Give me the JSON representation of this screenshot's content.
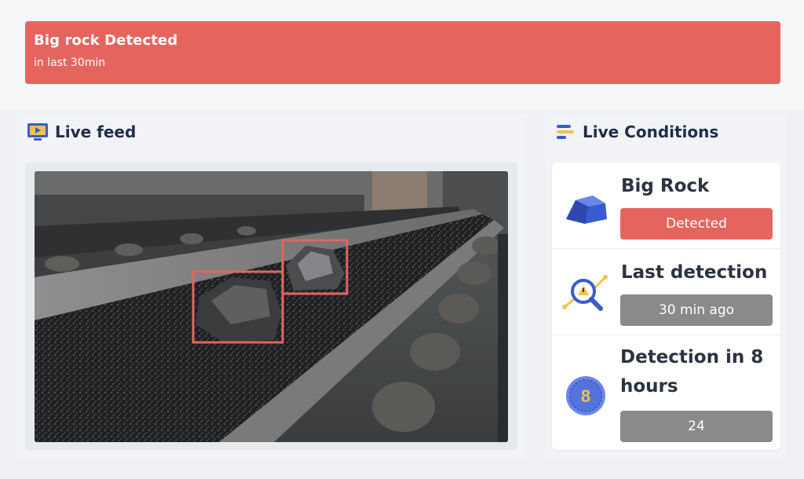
{
  "alert": {
    "title": "Big rock Detected",
    "subtitle": "in last 30min",
    "color": "#e5655e"
  },
  "feed": {
    "title": "Live feed",
    "icon": "video-play-icon"
  },
  "conditions": {
    "title": "Live Conditions",
    "icon": "list-bars-icon",
    "items": [
      {
        "label": "Big Rock",
        "value": "Detected",
        "icon": "rock-icon",
        "status_color": "#e5655e"
      },
      {
        "label": "Last detection",
        "value": "30 min ago",
        "icon": "search-chart-icon",
        "status_color": "#8a8a8c"
      },
      {
        "label": "Detection in 8 hours",
        "value": "24",
        "icon": "coin-8-icon",
        "icon_text": "8",
        "status_color": "#8a8a8c"
      }
    ]
  }
}
